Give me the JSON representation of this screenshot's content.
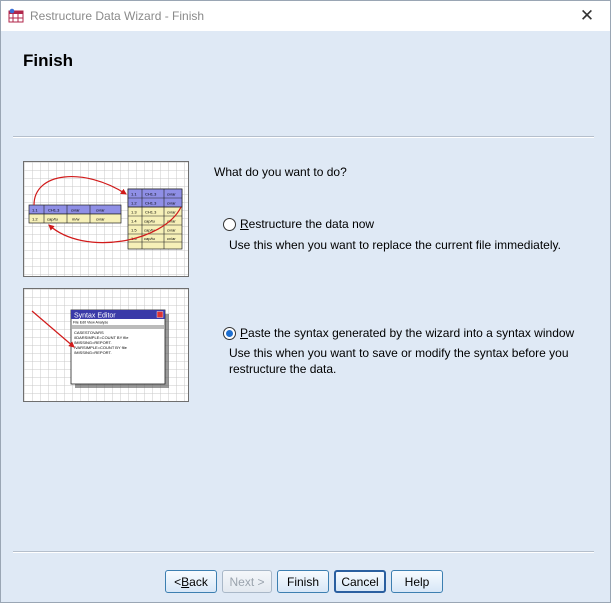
{
  "window": {
    "title": "Restructure Data Wizard - Finish",
    "close_glyph": "✕"
  },
  "page": {
    "title": "Finish",
    "question": "What do you want to do?"
  },
  "options": [
    {
      "mnemonic": "R",
      "label_rest": "estructure the data now",
      "description": "Use this when you want to replace the current file immediately.",
      "selected": false
    },
    {
      "mnemonic": "P",
      "label_rest": "aste the syntax generated by the wizard into a syntax window",
      "description": "Use this when you want to save or modify the syntax before you restructure the data.",
      "selected": true
    }
  ],
  "illustration_syntax": {
    "editor_title": "Syntax Editor",
    "menu": "File  Edit  View  Analyze",
    "lines": [
      "CASESTOVARS",
      "/IDARSIMPLE=COUNT BY file",
      "/MISSING=REPORT.",
      "/VARSIMPLE=COUNT BY file",
      "/MISSING=REPORT."
    ]
  },
  "illustration_restructure": {
    "cells_top": [
      "1.1",
      "CH1.3",
      "cv/ar"
    ],
    "cells_left": [
      "1.1",
      "CH1.3",
      "cv/ar",
      "cv/ar"
    ],
    "cells_left_row2": [
      "1.2",
      "cap/tu",
      "m/w",
      "cv/ar"
    ],
    "cells_right_rows": [
      "1.2",
      "CH1.3",
      "1.3",
      "1.4",
      "1.5",
      "1.6"
    ]
  },
  "buttons": {
    "back_mnemonic": "B",
    "back_rest": "ack",
    "back_prefix": "< ",
    "next": "Next >",
    "finish": "Finish",
    "cancel": "Cancel",
    "help": "Help"
  },
  "colors": {
    "accent": "#1e6fd0",
    "dialog_bg": "#dfe9f5",
    "arrow_red": "#d11a1a",
    "table_blue": "#8f8fe6",
    "table_yellow": "#f6f0b8"
  }
}
